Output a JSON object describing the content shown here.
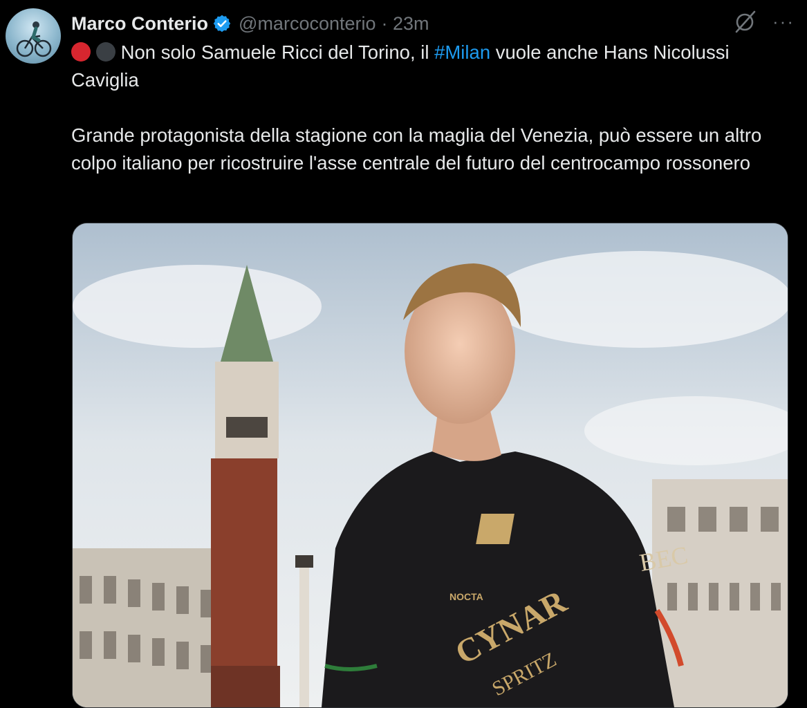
{
  "author": {
    "name": "Marco Conterio",
    "handle": "@marcoconterio",
    "time": "· 23m",
    "avatar_icon": "cyclist-avatar",
    "verified_icon": "verified-badge-icon"
  },
  "tweet": {
    "line1_text": "Non solo Samuele Ricci del Torino, il ",
    "hashtag": "#Milan",
    "line1_rest": " vuole anche Hans Nicolussi Caviglia",
    "paragraph2": "Grande protagonista della stagione con la maglia del Venezia, può essere un altro colpo italiano per ricostruire l'asse centrale del futuro del centrocampo rossonero",
    "emoji_colors": [
      "#d7262f",
      "#3a3f44"
    ]
  },
  "actions": {
    "more_label": "···"
  },
  "media": {
    "jersey_sponsor": "CYNAR",
    "jersey_sponsor_sub": "SPRITZ",
    "jersey_brand": "NOCTA",
    "jersey_side": "BEC"
  },
  "colors": {
    "accent": "#1d9bf0",
    "text": "#e7e9ea",
    "muted": "#71767b",
    "background": "#000000"
  }
}
